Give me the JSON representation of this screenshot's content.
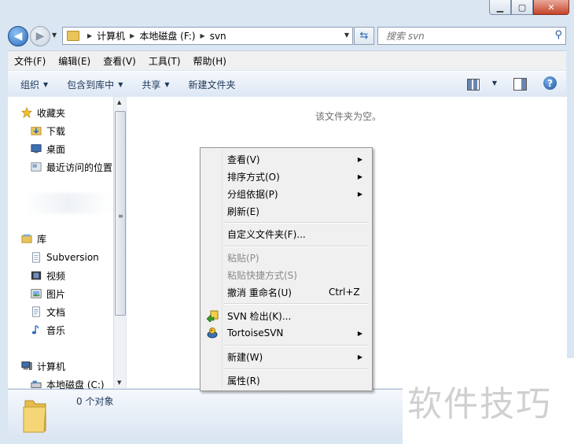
{
  "address": {
    "crumbs": [
      "计算机",
      "本地磁盘 (F:)",
      "svn"
    ]
  },
  "search": {
    "placeholder": "搜索 svn"
  },
  "menubar": [
    "文件(F)",
    "编辑(E)",
    "查看(V)",
    "工具(T)",
    "帮助(H)"
  ],
  "commands": {
    "organize": "组织",
    "include_library": "包含到库中",
    "share": "共享",
    "new_folder": "新建文件夹"
  },
  "nav": {
    "favorites": "收藏夹",
    "downloads": "下载",
    "desktop": "桌面",
    "recent": "最近访问的位置",
    "libraries": "库",
    "subversion": "Subversion",
    "videos": "视频",
    "pictures": "图片",
    "documents": "文档",
    "music": "音乐",
    "computer": "计算机",
    "local_disk": "本地磁盘 (C:)"
  },
  "content": {
    "empty_message": "该文件夹为空。"
  },
  "status": {
    "count": "0 个对象"
  },
  "context_menu": {
    "view": "查看(V)",
    "sort": "排序方式(O)",
    "group": "分组依据(P)",
    "refresh": "刷新(E)",
    "customize": "自定义文件夹(F)...",
    "paste": "粘贴(P)",
    "paste_shortcut": "粘贴快捷方式(S)",
    "undo_rename": "撤消 重命名(U)",
    "undo_shortcut": "Ctrl+Z",
    "svn_checkout": "SVN 检出(K)...",
    "tortoise": "TortoiseSVN",
    "new": "新建(W)",
    "properties": "属性(R)"
  },
  "watermark": "软件技巧"
}
